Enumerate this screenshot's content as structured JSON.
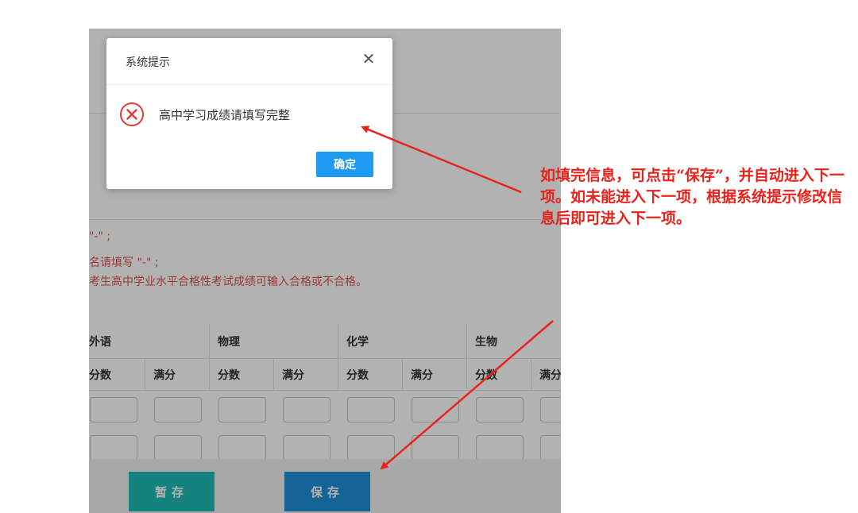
{
  "notes": [
    "\"-\" ;",
    "名请填写 \"-\" ;",
    "考生高中学业水平合格性考试成绩可输入合格或不合格。"
  ],
  "table": {
    "subjects": [
      "外语",
      "物理",
      "化学",
      "生物"
    ],
    "sub_headers": [
      "分数",
      "满分",
      "分数",
      "满分",
      "分数",
      "满分",
      "分数",
      "满分"
    ]
  },
  "footer": {
    "temp_save_label": "暂存",
    "save_label": "保存"
  },
  "modal": {
    "title": "系统提示",
    "close_symbol": "✕",
    "message": "高中学习成绩请填写完整",
    "ok_label": "确定",
    "icon": "error-circle-x-icon",
    "icon_color": "#e8392d"
  },
  "annotation": {
    "text": "如填完信息，可点击“保存”，并自动进入下一项。如未能进入下一项，根据系统提示修改信息后即可进入下一项。",
    "color": "#e8231c"
  },
  "colors": {
    "accent": "#1e9bf0",
    "temp_button": "#1fbcb4",
    "save_button": "#1e90d8",
    "note_red": "#d9534f"
  }
}
